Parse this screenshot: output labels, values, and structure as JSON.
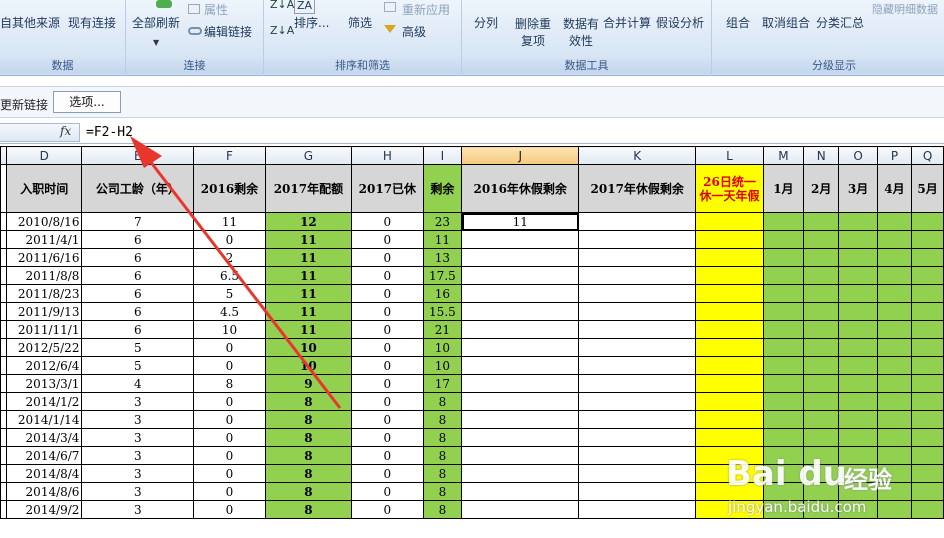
{
  "ribbon": {
    "groups": [
      {
        "label": "数据",
        "buttons": [
          "自其他来源",
          "现有连接"
        ]
      },
      {
        "label": "连接",
        "buttons": [
          "全部刷新",
          "属性",
          "编辑链接"
        ]
      },
      {
        "label": "排序和筛选",
        "buttons": [
          "排序...",
          "筛选",
          "重新应用",
          "高级"
        ]
      },
      {
        "label": "数据工具",
        "buttons": [
          "分列",
          "删除重复项",
          "数据有效性",
          "合并计算",
          "假设分析"
        ]
      },
      {
        "label": "分级显示",
        "buttons": [
          "组合",
          "取消组合",
          "分类汇总",
          "隐藏明细数据"
        ]
      }
    ]
  },
  "msgbar": {
    "text": "更新链接",
    "options": "选项..."
  },
  "formula_bar": {
    "fx": "fx",
    "formula": "=F2-H2"
  },
  "columns": [
    "D",
    "E",
    "F",
    "G",
    "H",
    "I",
    "J",
    "K",
    "L",
    "M",
    "N",
    "O",
    "P",
    "Q"
  ],
  "header_row": [
    "入职时间",
    "公司工龄（年）",
    "2016剩余",
    "2017年配额",
    "2017已休",
    "剩余",
    "2016年休假剩余",
    "2017年休假剩余",
    "26日统一休一天年假",
    "1月",
    "2月",
    "3月",
    "4月",
    "5月"
  ],
  "rows": [
    [
      "2010/8/16",
      "7",
      "11",
      "12",
      "0",
      "23",
      "11"
    ],
    [
      "2011/4/1",
      "6",
      "0",
      "11",
      "0",
      "11",
      ""
    ],
    [
      "2011/6/16",
      "6",
      "2",
      "11",
      "0",
      "13",
      ""
    ],
    [
      "2011/8/8",
      "6",
      "6.5",
      "11",
      "0",
      "17.5",
      ""
    ],
    [
      "2011/8/23",
      "6",
      "5",
      "11",
      "0",
      "16",
      ""
    ],
    [
      "2011/9/13",
      "6",
      "4.5",
      "11",
      "0",
      "15.5",
      ""
    ],
    [
      "2011/11/1",
      "6",
      "10",
      "11",
      "0",
      "21",
      ""
    ],
    [
      "2012/5/22",
      "5",
      "0",
      "10",
      "0",
      "10",
      ""
    ],
    [
      "2012/6/4",
      "5",
      "0",
      "10",
      "0",
      "10",
      ""
    ],
    [
      "2013/3/1",
      "4",
      "8",
      "9",
      "0",
      "17",
      ""
    ],
    [
      "2014/1/2",
      "3",
      "0",
      "8",
      "0",
      "8",
      ""
    ],
    [
      "2014/1/14",
      "3",
      "0",
      "8",
      "0",
      "8",
      ""
    ],
    [
      "2014/3/4",
      "3",
      "0",
      "8",
      "0",
      "8",
      ""
    ],
    [
      "2014/6/7",
      "3",
      "0",
      "8",
      "0",
      "8",
      ""
    ],
    [
      "2014/8/4",
      "3",
      "0",
      "8",
      "0",
      "8",
      ""
    ],
    [
      "2014/8/6",
      "3",
      "0",
      "8",
      "0",
      "8",
      ""
    ],
    [
      "2014/9/2",
      "3",
      "0",
      "8",
      "0",
      "8",
      ""
    ]
  ],
  "watermark": {
    "logo": "Bai du",
    "cn": "经验",
    "url": "jingyan.baidu.com"
  },
  "colors": {
    "green": "#92d050",
    "yellow": "#ffff00",
    "arrow": "#e8362d"
  }
}
